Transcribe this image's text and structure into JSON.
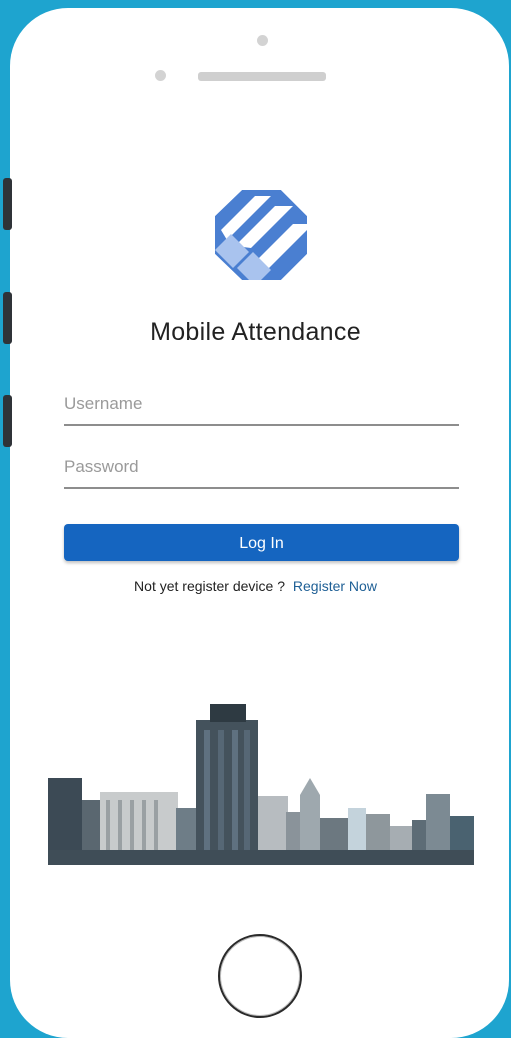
{
  "app": {
    "title": "Mobile Attendance",
    "logo_icon": "app-logo-icon",
    "brand_color": "#4a7fd1"
  },
  "form": {
    "username_placeholder": "Username",
    "password_placeholder": "Password",
    "login_label": "Log In",
    "login_color": "#1565c0"
  },
  "register": {
    "prompt": "Not yet register device ?",
    "link_label": "Register Now"
  },
  "device": {
    "frame_color": "#1ea4cf",
    "home_button_icon": "home-button-icon"
  }
}
